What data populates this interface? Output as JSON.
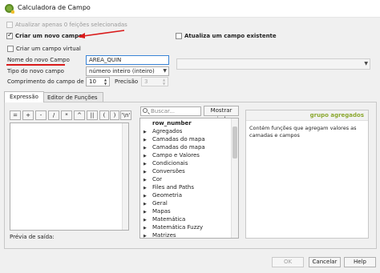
{
  "window": {
    "title": "Calculadora de Campo"
  },
  "options": {
    "only_selected_label": "Atualizar apenas 0 feições selecionadas",
    "create_new_label": "Criar um novo campo",
    "update_existing_label": "Atualiza um campo existente",
    "virtual_label": "Criar um campo virtual"
  },
  "new_field": {
    "name_label": "Nome do novo Campo",
    "name_value": "AREA_QUIN",
    "type_label": "Tipo do novo campo",
    "type_value": "número inteiro (inteiro)",
    "length_label": "Comprimento do campo de saída",
    "length_value": "10",
    "precision_label": "Precisão",
    "precision_value": "3"
  },
  "tabs": [
    "Expressão",
    "Editor de Funções"
  ],
  "operators": [
    "=",
    "+",
    "-",
    "/",
    "*",
    "^",
    "||",
    "(",
    ")",
    "'\\n'"
  ],
  "preview_label": "Prévia de saída:",
  "search": {
    "placeholder": "Buscar..."
  },
  "show_help_label": "Mostrar ajuda",
  "functions": [
    "row_number",
    "Agregados",
    "Camadas do mapa",
    "Camadas do mapa",
    "Campo e Valores",
    "Condicionais",
    "Conversões",
    "Cor",
    "Files and Paths",
    "Geometria",
    "Geral",
    "Mapas",
    "Matemática",
    "Matemática Fuzzy",
    "Matrizes"
  ],
  "help": {
    "heading": "grupo agregados",
    "text": "Contém funções que agregam valores as camadas e campos"
  },
  "buttons": {
    "ok": "OK",
    "cancel": "Cancelar",
    "help": "Help"
  },
  "colors": {
    "annotation": "#d91a1a",
    "help_heading": "#8ba82f"
  }
}
